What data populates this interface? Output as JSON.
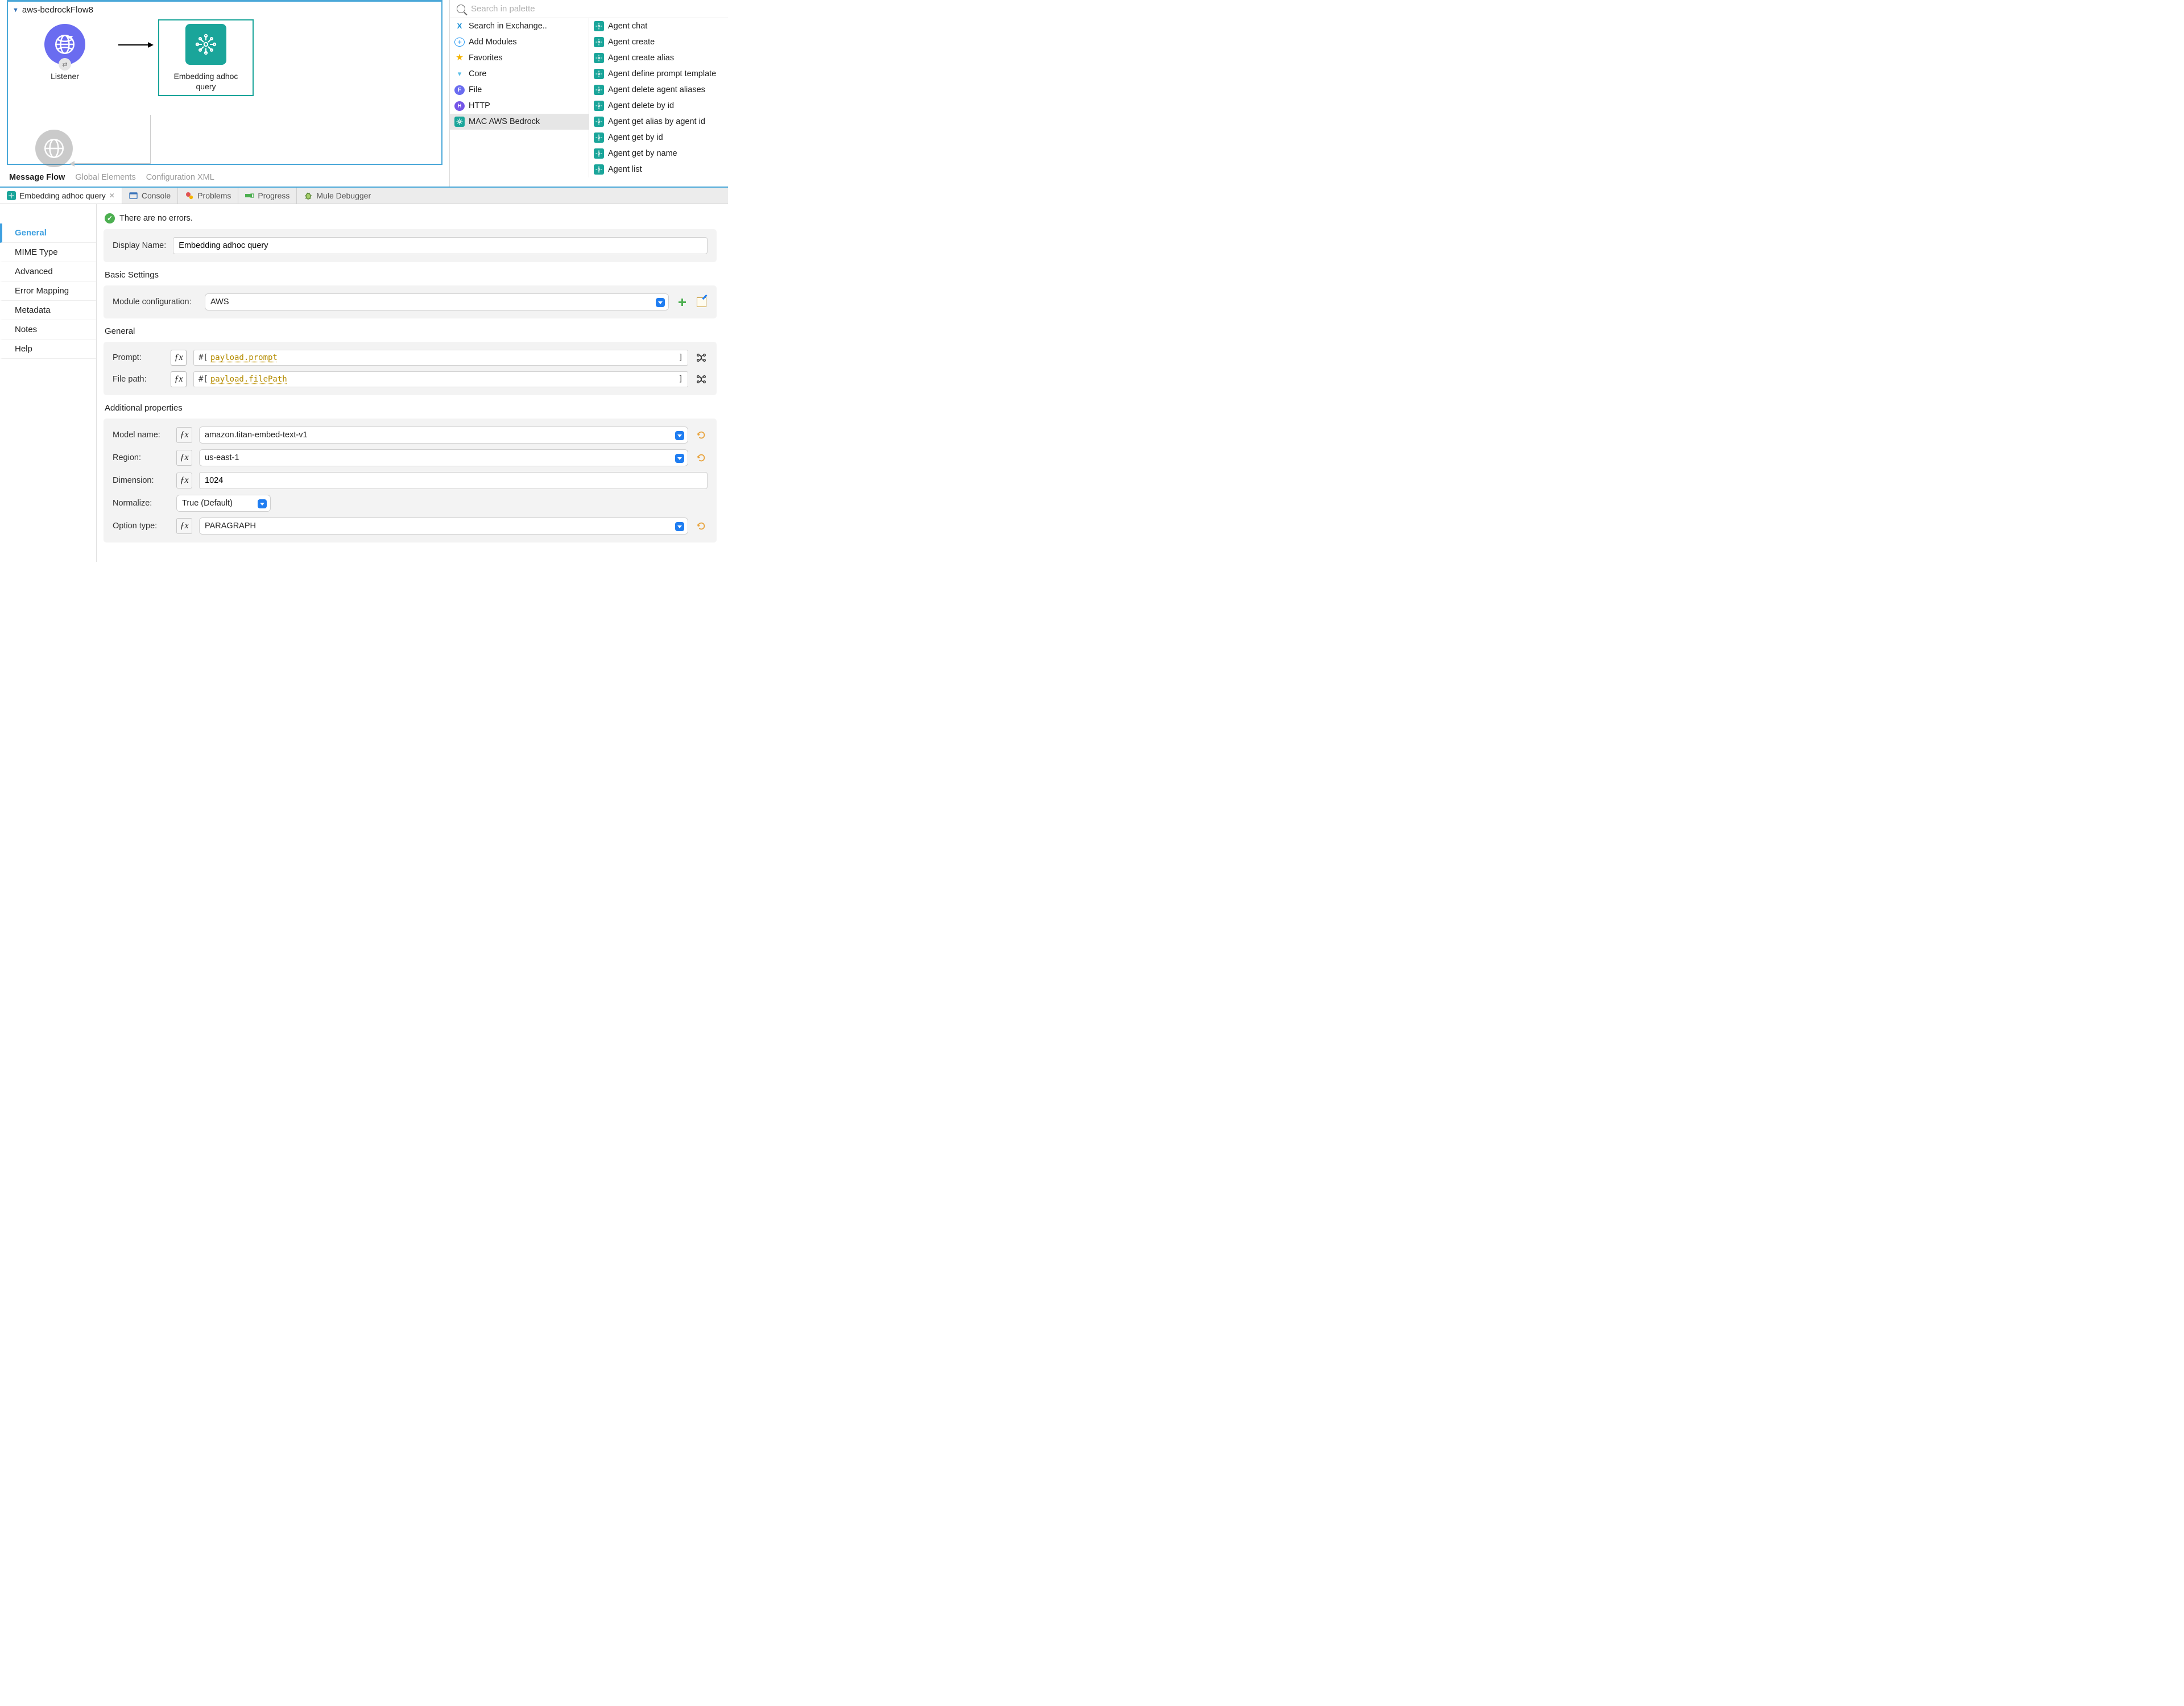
{
  "flow": {
    "name": "aws-bedrockFlow8",
    "nodes": {
      "listener": "Listener",
      "embedding": "Embedding adhoc query"
    }
  },
  "canvas_tabs": [
    "Message Flow",
    "Global Elements",
    "Configuration XML"
  ],
  "palette": {
    "search_placeholder": "Search in palette",
    "left": [
      {
        "label": "Search in Exchange..",
        "icon": "exchange"
      },
      {
        "label": "Add Modules",
        "icon": "plus-circle"
      },
      {
        "label": "Favorites",
        "icon": "star"
      },
      {
        "label": "Core",
        "icon": "core"
      },
      {
        "label": "File",
        "icon": "file"
      },
      {
        "label": "HTTP",
        "icon": "http"
      },
      {
        "label": "MAC AWS Bedrock",
        "icon": "bedrock",
        "selected": true
      }
    ],
    "right": [
      "Agent chat",
      "Agent create",
      "Agent create alias",
      "Agent define prompt template",
      "Agent delete agent aliases",
      "Agent delete by id",
      "Agent get alias by agent id",
      "Agent get by id",
      "Agent get by name",
      "Agent list"
    ]
  },
  "bottom_tabs": {
    "active": "Embedding adhoc query",
    "others": [
      "Console",
      "Problems",
      "Progress",
      "Mule Debugger"
    ]
  },
  "props": {
    "side": [
      "General",
      "MIME Type",
      "Advanced",
      "Error Mapping",
      "Metadata",
      "Notes",
      "Help"
    ],
    "status": "There are no errors.",
    "display_name_label": "Display Name:",
    "display_name": "Embedding adhoc query",
    "basic_title": "Basic Settings",
    "module_cfg_label": "Module configuration:",
    "module_cfg": "AWS",
    "general_title": "General",
    "prompt_label": "Prompt:",
    "prompt_prefix": "#[",
    "prompt_expr": "payload.prompt",
    "filepath_label": "File path:",
    "filepath_expr": "payload.filePath",
    "addl_title": "Additional properties",
    "model_label": "Model name:",
    "model": "amazon.titan-embed-text-v1",
    "region_label": "Region:",
    "region": "us-east-1",
    "dim_label": "Dimension:",
    "dim": "1024",
    "norm_label": "Normalize:",
    "norm": "True (Default)",
    "opt_label": "Option type:",
    "opt": "PARAGRAPH"
  }
}
